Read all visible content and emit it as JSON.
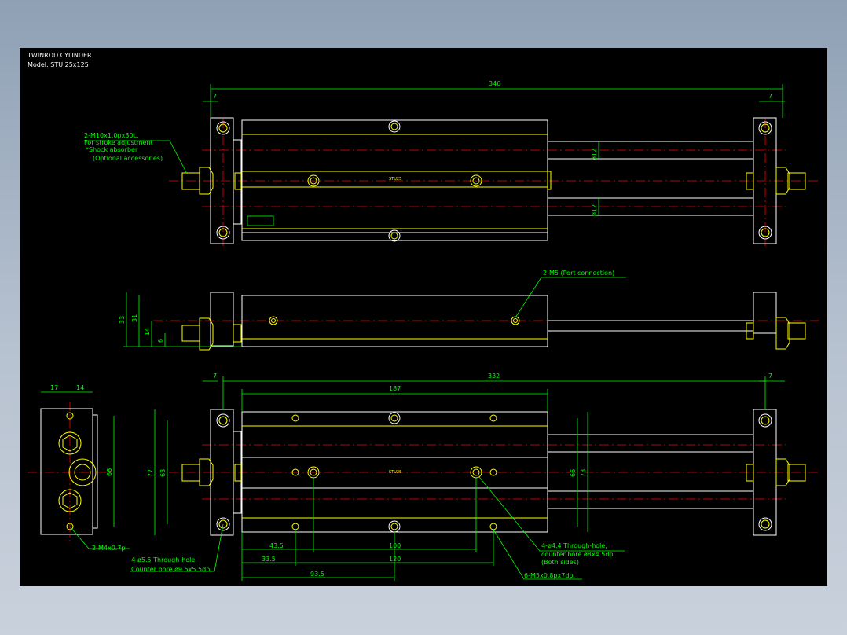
{
  "title": {
    "line1": "TWINROD CYLINDER",
    "line2": "Model: STU 25x125"
  },
  "dimensions": {
    "top_overall": "346",
    "top_left_small": "7",
    "top_right_small": "7",
    "rod_dia_upper": "ø12",
    "rod_dia_lower": "ø12",
    "side_h33": "33",
    "side_h31": "31",
    "side_h14": "14",
    "side_h6": "6",
    "bot_left_small": "7",
    "bot_overall": "332",
    "bot_right_small": "7",
    "bot_187": "187",
    "end_w17": "17",
    "end_w14": "14",
    "end_h66": "66",
    "bot_h77": "77",
    "bot_h63": "63",
    "bot_h66": "66",
    "bot_h73": "73",
    "bot_43_5": "43.5",
    "bot_100": "100",
    "bot_33_5": "33.5",
    "bot_120": "120",
    "bot_93_5": "93.5"
  },
  "notes": {
    "top_note_l1": "2-M10x1.0px30L.",
    "top_note_l2": "For stroke adjustment",
    "top_note_l3": "*Shock absorber",
    "top_note_l4": "(Optional accessories)",
    "port_note": "2-M5 (Port connection)",
    "m4_note": "2-M4x0.7p",
    "hole55_l1": "4-ø5.5 Through-hole,",
    "hole55_l2": "Counter bore ø9.5x5.5dp.",
    "hole44_l1": "4-ø4.4 Through-hole,",
    "hole44_l2": "counter bore ø8x4.5dp.",
    "hole44_l3": "(Both sides)",
    "m5_note": "6-M5x0.8px7dp."
  },
  "labels": {
    "body_mark_top": "STU25",
    "body_mark_bottom": "STU25"
  },
  "colors": {
    "background": "#000000",
    "outline": "#ffffff",
    "parts": "#ffff00",
    "dimension": "#00ff00",
    "centerline": "#ff0000"
  }
}
